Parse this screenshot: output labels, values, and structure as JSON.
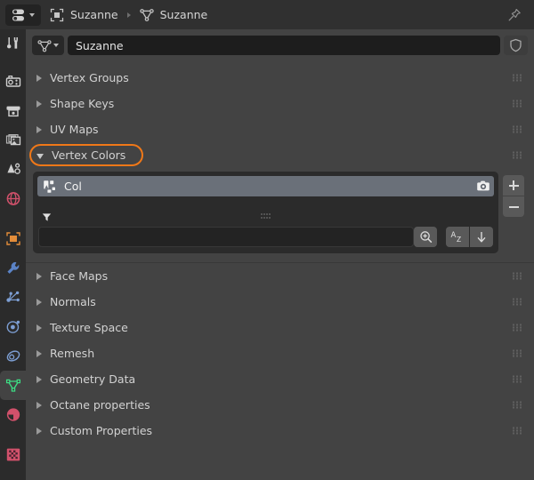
{
  "app": {
    "editor": "properties-editor",
    "background": "#434343",
    "accent_highlight": "#f07818",
    "selected_row_color": "#6a7079"
  },
  "topbar": {
    "editor_type_icon": "properties-editor-icon",
    "breadcrumb": [
      {
        "icon": "object-icon",
        "label": "Suzanne"
      },
      {
        "icon": "mesh-data-icon",
        "label": "Suzanne"
      }
    ],
    "pin_icon": "pin-icon",
    "pin_label": ""
  },
  "tabs": [
    {
      "name": "tool",
      "icon": "tool-icon",
      "active": false
    },
    {
      "name": "render",
      "icon": "render-camera-icon",
      "active": false
    },
    {
      "name": "output",
      "icon": "output-printer-icon",
      "active": false
    },
    {
      "name": "view-layer",
      "icon": "view-layer-images-icon",
      "active": false
    },
    {
      "name": "scene",
      "icon": "scene-cone-icon",
      "active": false
    },
    {
      "name": "world",
      "icon": "world-globe-icon",
      "active": false
    },
    {
      "name": "object",
      "icon": "object-square-icon",
      "active": false
    },
    {
      "name": "modifiers",
      "icon": "wrench-icon",
      "active": false
    },
    {
      "name": "particles",
      "icon": "particles-icon",
      "active": false
    },
    {
      "name": "physics",
      "icon": "physics-orbit-icon",
      "active": false
    },
    {
      "name": "object-constraints",
      "icon": "constraints-icon",
      "active": false
    },
    {
      "name": "object-data",
      "icon": "mesh-data-triangle-icon",
      "active": true
    },
    {
      "name": "material",
      "icon": "material-sphere-icon",
      "active": false
    },
    {
      "name": "texture",
      "icon": "texture-checker-icon",
      "active": false
    }
  ],
  "id_row": {
    "type_icon": "mesh-data-icon",
    "dropdown_icon": "chevron-down-icon",
    "name_value": "Suzanne",
    "name_placeholder": "Name",
    "fake_user_icon": "shield-icon"
  },
  "panels": [
    {
      "title": "Vertex Groups",
      "open": false,
      "highlighted": false
    },
    {
      "title": "Shape Keys",
      "open": false,
      "highlighted": false
    },
    {
      "title": "UV Maps",
      "open": false,
      "highlighted": false
    },
    {
      "title": "Vertex Colors",
      "open": true,
      "highlighted": true
    },
    {
      "title": "Face Maps",
      "open": false,
      "highlighted": false
    },
    {
      "title": "Normals",
      "open": false,
      "highlighted": false
    },
    {
      "title": "Texture Space",
      "open": false,
      "highlighted": false
    },
    {
      "title": "Remesh",
      "open": false,
      "highlighted": false
    },
    {
      "title": "Geometry Data",
      "open": false,
      "highlighted": false
    },
    {
      "title": "Octane properties",
      "open": false,
      "highlighted": false
    },
    {
      "title": "Custom Properties",
      "open": false,
      "highlighted": false
    }
  ],
  "vertex_colors": {
    "item": {
      "icon": "vertex-color-data-icon",
      "name": "Col",
      "render_icon": "camera-render-icon"
    },
    "filter_icon": "filter-funnel-icon",
    "list_grip_icon": "drag-dots-icon",
    "search_value": "",
    "search_placeholder": "",
    "search_add_icon": "magnifier-plus-icon",
    "sort_alpha_icon": "sort-alphabetical-icon",
    "sort_direction_icon": "arrow-down-icon",
    "add_button_icon": "plus-icon",
    "remove_button_icon": "minus-icon"
  }
}
